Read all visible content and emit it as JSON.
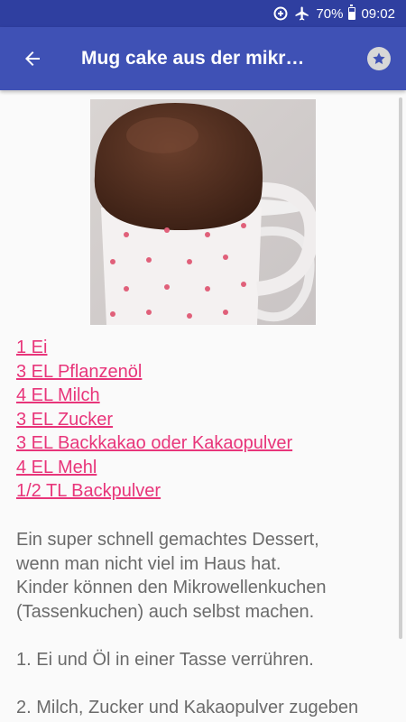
{
  "status_bar": {
    "battery": "70%",
    "time": "09:02",
    "icons": [
      "data-saver-icon",
      "airplane-icon",
      "battery-icon"
    ]
  },
  "app_bar": {
    "title": "Mug cake aus der mikr…",
    "back_icon": "arrow-left-icon",
    "favorite_icon": "star-icon"
  },
  "ingredients": [
    "1 Ei",
    "3 EL Pflanzenöl",
    "4 EL Milch",
    "3 EL Zucker",
    "3 EL Backkakao oder Kakaopulver",
    "4 EL Mehl",
    "1/2 TL Backpulver"
  ],
  "description": {
    "line1": "Ein super schnell gemachtes Dessert,",
    "line2": "wenn man nicht viel im Haus hat.",
    "line3": "Kinder können den Mikrowellenkuchen",
    "line4": "(Tassenkuchen) auch selbst machen.",
    "step1": "1. Ei und Öl in einer Tasse verrühren.",
    "step2": "2. Milch, Zucker und Kakaopulver zugeben"
  },
  "colors": {
    "status_bar": "#2f3fa0",
    "app_bar": "#3f51b5",
    "link": "#e8357a",
    "body_text": "#6b6b6b"
  }
}
